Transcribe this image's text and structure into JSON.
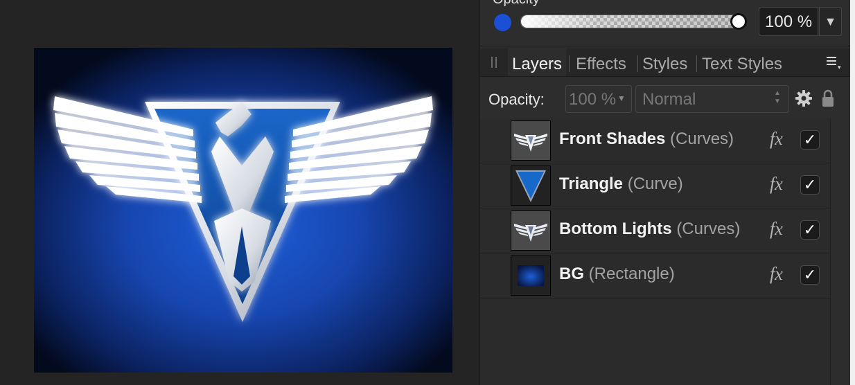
{
  "color_panel": {
    "title": "Opacity",
    "swatch_color": "#1a4fd6",
    "opacity_percent": 100,
    "opacity_value": "100 %",
    "dropdown_arrow": "▼"
  },
  "tabs": [
    {
      "label": "Layers",
      "active": true
    },
    {
      "label": "Effects",
      "active": false
    },
    {
      "label": "Styles",
      "active": false
    },
    {
      "label": "Text Styles",
      "active": false
    }
  ],
  "layer_options": {
    "opacity_label": "Opacity:",
    "opacity_value": "100 %",
    "blend_mode": "Normal"
  },
  "layers": [
    {
      "name": "Front Shades",
      "type": "(Curves)",
      "fx": "fx",
      "visible": true,
      "thumb": "eagle-thumbnail"
    },
    {
      "name": "Triangle",
      "type": "(Curve)",
      "fx": "fx",
      "visible": true,
      "thumb": "triangle-thumbnail"
    },
    {
      "name": "Bottom Lights",
      "type": "(Curves)",
      "fx": "fx",
      "visible": true,
      "thumb": "eagle-thumbnail"
    },
    {
      "name": "BG",
      "type": "(Rectangle)",
      "fx": "fx",
      "visible": true,
      "thumb": "rectangle-thumbnail"
    }
  ],
  "checkmark": "✓",
  "colors": {
    "accent": "#1a4fd6",
    "panel_bg": "#2d2d2d",
    "canvas_bg": "#242424"
  }
}
